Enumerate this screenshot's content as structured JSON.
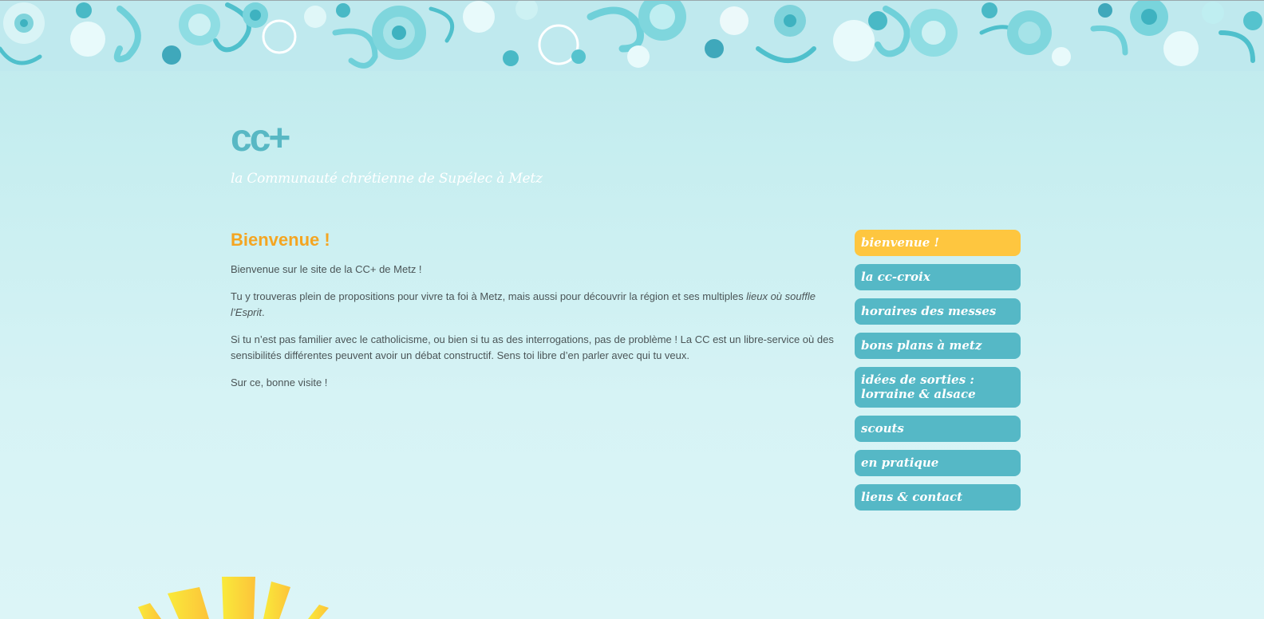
{
  "header": {
    "logo": "cc+",
    "tagline": "la Communauté chrétienne de Supélec à Metz"
  },
  "main": {
    "title": "Bienvenue !",
    "paragraphs": [
      "Bienvenue sur le site de la CC+ de Metz !",
      "Si tu n’est pas familier avec le catholicisme, ou bien si tu as des interrogations, pas de problème ! La CC est un libre-service où des sensibilités différentes peuvent avoir un débat constructif. Sens toi libre d’en parler avec qui tu veux.",
      "Sur ce, bonne visite !"
    ],
    "paragraph2": {
      "text": "Tu y trouveras plein de propositions pour vivre ta foi à Metz, mais aussi pour découvrir la région et ses multiples ",
      "italic": "lieux où souffle l’Esprit",
      "end": "."
    }
  },
  "nav": {
    "items": [
      {
        "label": "bienvenue !",
        "active": true
      },
      {
        "label": "la cc-croix",
        "active": false
      },
      {
        "label": "horaires des messes",
        "active": false
      },
      {
        "label": "bons plans à metz",
        "active": false
      },
      {
        "label": "idées de sorties :\nlorraine & alsace",
        "active": false
      },
      {
        "label": "scouts",
        "active": false
      },
      {
        "label": "en pratique",
        "active": false
      },
      {
        "label": "liens & contact",
        "active": false
      }
    ]
  },
  "colors": {
    "accent_heading": "#f4a521",
    "nav_default": "#55b8c6",
    "nav_active": "#fec63f",
    "logo": "#58b8c4",
    "swirl_dark": "#4fc0cc",
    "swirl_light": "#a6e3e8"
  }
}
